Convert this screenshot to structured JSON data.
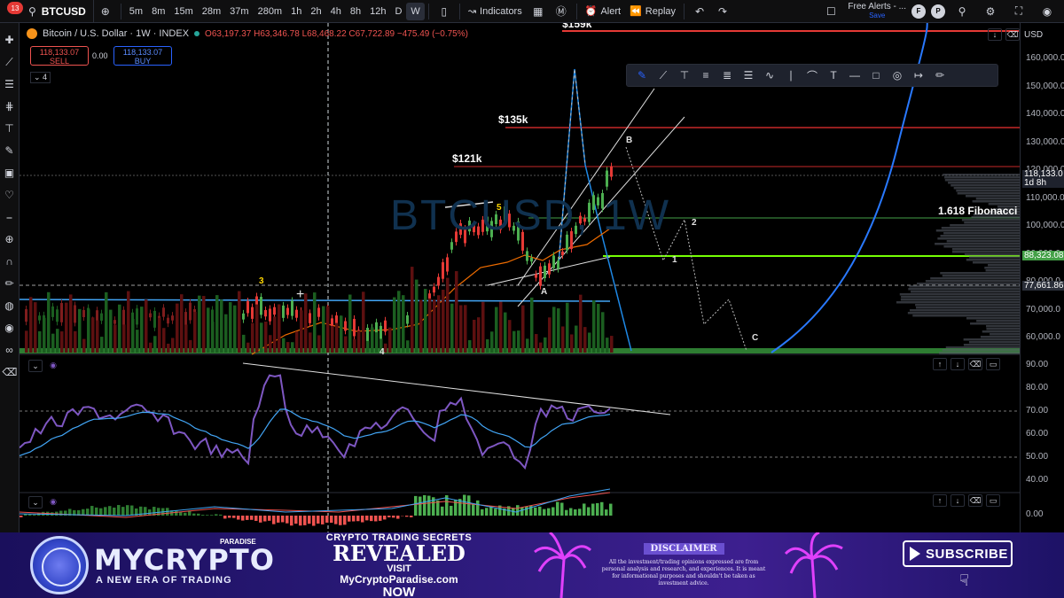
{
  "toolbar": {
    "notification_count": "13",
    "symbol": "BTCUSD",
    "intervals": [
      "5m",
      "8m",
      "15m",
      "28m",
      "37m",
      "280m",
      "1h",
      "2h",
      "4h",
      "8h",
      "12h",
      "D",
      "W"
    ],
    "active_interval": "W",
    "indicators_label": "Indicators",
    "alert_label": "Alert",
    "replay_label": "Replay",
    "free_alerts_label": "Free Alerts - ...",
    "save_label": "Save",
    "avatar_f": "F",
    "avatar_p": "P"
  },
  "legend": {
    "title": "Bitcoin / U.S. Dollar · 1W · INDEX",
    "ohlc": "O63,197.37 H63,346.78 L68,468.22 C67,722.89 −475.49 (−0.75%)",
    "sell_price": "118,133.07",
    "sell_label": "SELL",
    "buy_price": "118,133.07",
    "buy_label": "BUY",
    "spread": "0.00",
    "indicator_count": "4"
  },
  "chart": {
    "watermark": "BTCUSD, 1W",
    "labels": {
      "top_level": "$159k",
      "level_135": "$135k",
      "level_121": "$121k",
      "fib": "1.618 Fibonacci"
    },
    "waves": {
      "w3": "3",
      "w4": "4",
      "w5": "5",
      "A": "A",
      "B": "B",
      "C": "C",
      "w1": "1",
      "w2": "2"
    }
  },
  "price_axis": {
    "currency": "USD",
    "ticks": [
      "160,000.0",
      "150,000.0",
      "140,000.0",
      "130,000.0",
      "120,000.0",
      "110,000.0",
      "100,000.0",
      "90,000.0",
      "80,000.0",
      "70,000.0",
      "60,000.0"
    ],
    "current_price": "118,133.0",
    "current_time": "1d 8h",
    "fib_price": "88,323.08",
    "low_price": "77,661.86"
  },
  "rsi_axis": {
    "ticks": [
      "90.00",
      "80.00",
      "70.00",
      "60.00",
      "50.00",
      "40.00"
    ]
  },
  "macd_axis": {
    "ticks": [
      "0.00"
    ]
  },
  "banner": {
    "brand_small": "PARADISE",
    "brand": "MYCRYPTO",
    "tagline": "A NEW ERA OF TRADING",
    "promo_line1": "CRYPTO TRADING SECRETS",
    "promo_line2": "REVEALED",
    "promo_line3": "VISIT",
    "promo_line4": "MyCryptoParadise.com",
    "promo_line5": "NOW",
    "disclaimer_title": "DISCLAIMER",
    "disclaimer_text": "All the investment/trading opinions expressed are from personal analysis and research, and experiences. It is meant for informational purposes and shouldn't be taken as investment advice.",
    "subscribe_label": "SUBSCRIBE"
  }
}
